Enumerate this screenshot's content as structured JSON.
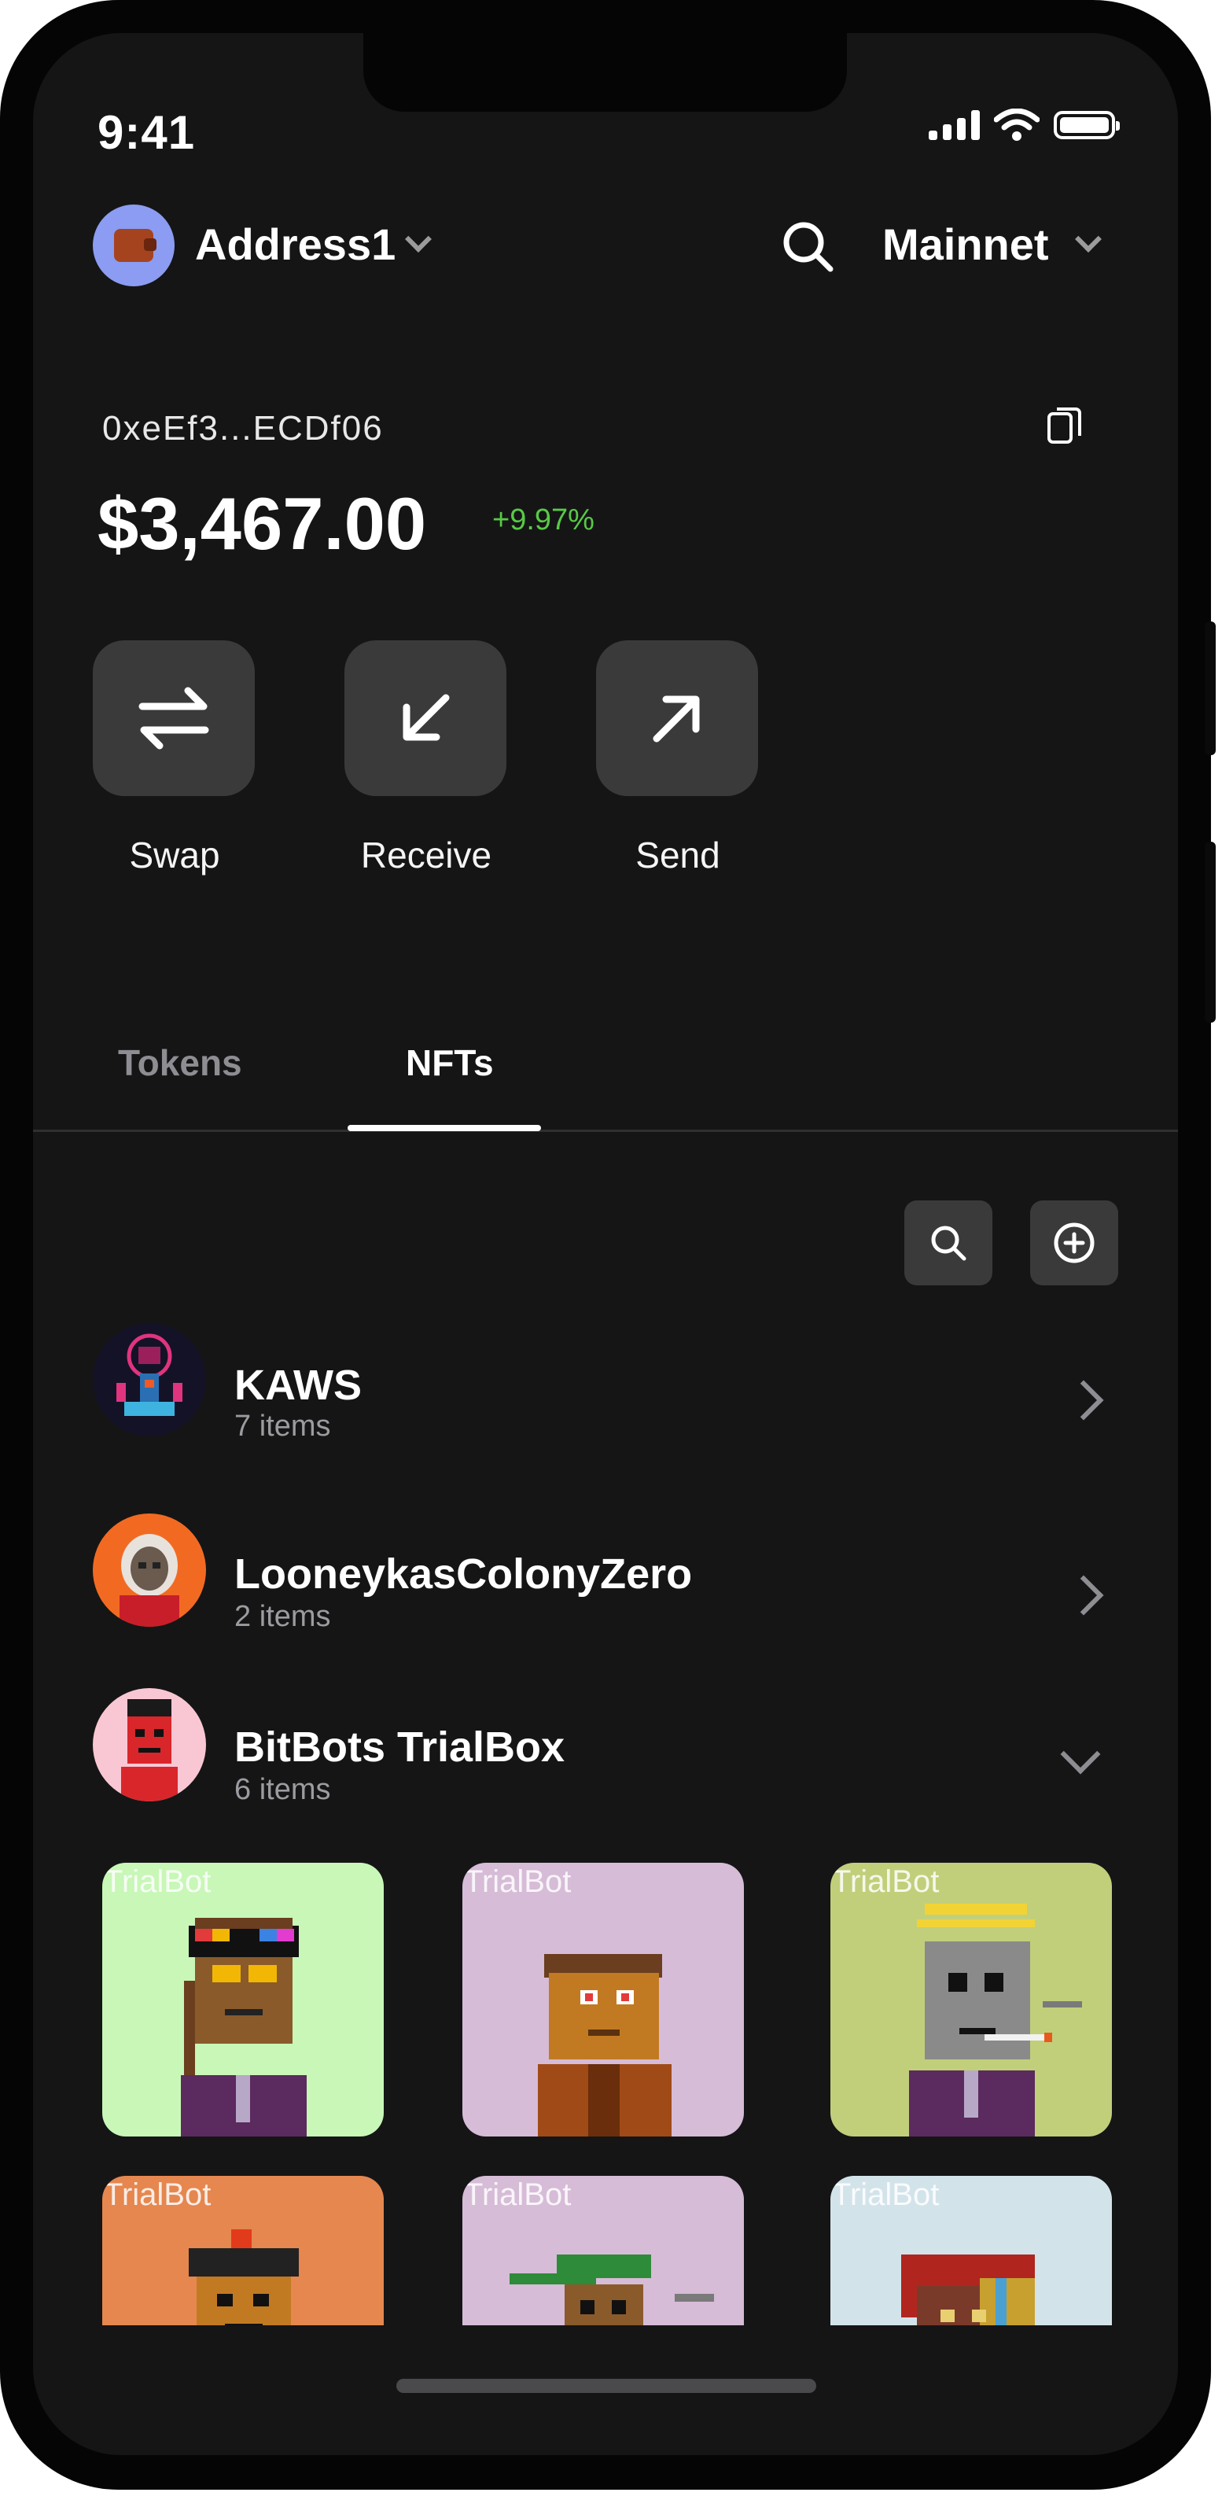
{
  "status_bar": {
    "time": "9:41"
  },
  "header": {
    "account_name": "Address1",
    "network": "Mainnet"
  },
  "wallet": {
    "address": "0xeEf3...ECDf06",
    "balance": "$3,467.00",
    "change": "+9.97%"
  },
  "actions": [
    {
      "label": "Swap",
      "icon": "swap-arrows-icon"
    },
    {
      "label": "Receive",
      "icon": "arrow-down-left-icon"
    },
    {
      "label": "Send",
      "icon": "arrow-up-right-icon"
    }
  ],
  "tabs": [
    {
      "label": "Tokens",
      "active": false
    },
    {
      "label": "NFTs",
      "active": true
    }
  ],
  "collections": [
    {
      "name": "KAWS",
      "count": "7 items",
      "expanded": false
    },
    {
      "name": "LooneykasColonyZero",
      "count": "2 items",
      "expanded": false
    },
    {
      "name": "BitBots TrialBox",
      "count": "6 items",
      "expanded": true
    }
  ],
  "nft_cards": [
    {
      "label": "TrialBot",
      "bg": "#c8f7b8"
    },
    {
      "label": "TrialBot",
      "bg": "#d6bcd7"
    },
    {
      "label": "TrialBot",
      "bg": "#c1cf7b"
    },
    {
      "label": "TrialBot",
      "bg": "#e5874f"
    },
    {
      "label": "TrialBot",
      "bg": "#d6bcd7"
    },
    {
      "label": "TrialBot",
      "bg": "#d3e3ea"
    }
  ],
  "colors": {
    "accent_positive": "#58c946",
    "background": "#151516",
    "button": "#3a3a3b"
  }
}
